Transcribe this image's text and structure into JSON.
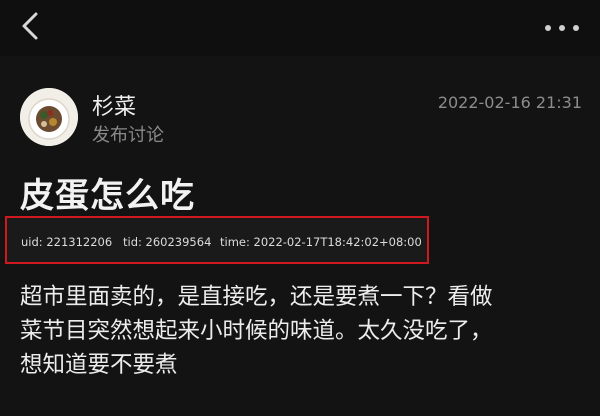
{
  "header": {
    "back_icon": "chevron-left-icon",
    "more_icon": "more-dots-icon"
  },
  "post": {
    "author": "杉菜",
    "author_action": "发布讨论",
    "timestamp": "2022-02-16 21:31",
    "title": "皮蛋怎么吃",
    "meta": {
      "uid": "uid: 221312206",
      "tid": "tid: 260239564",
      "time": "time: 2022-02-17T18:42:02+08:00",
      "highlight_color": "#d0191f"
    },
    "body_lines": [
      "超市里面卖的，是直接吃，还是要煮一下？看做",
      "菜节目突然想起来小时候的味道。太久没吃了，",
      "想知道要不要煮"
    ]
  }
}
